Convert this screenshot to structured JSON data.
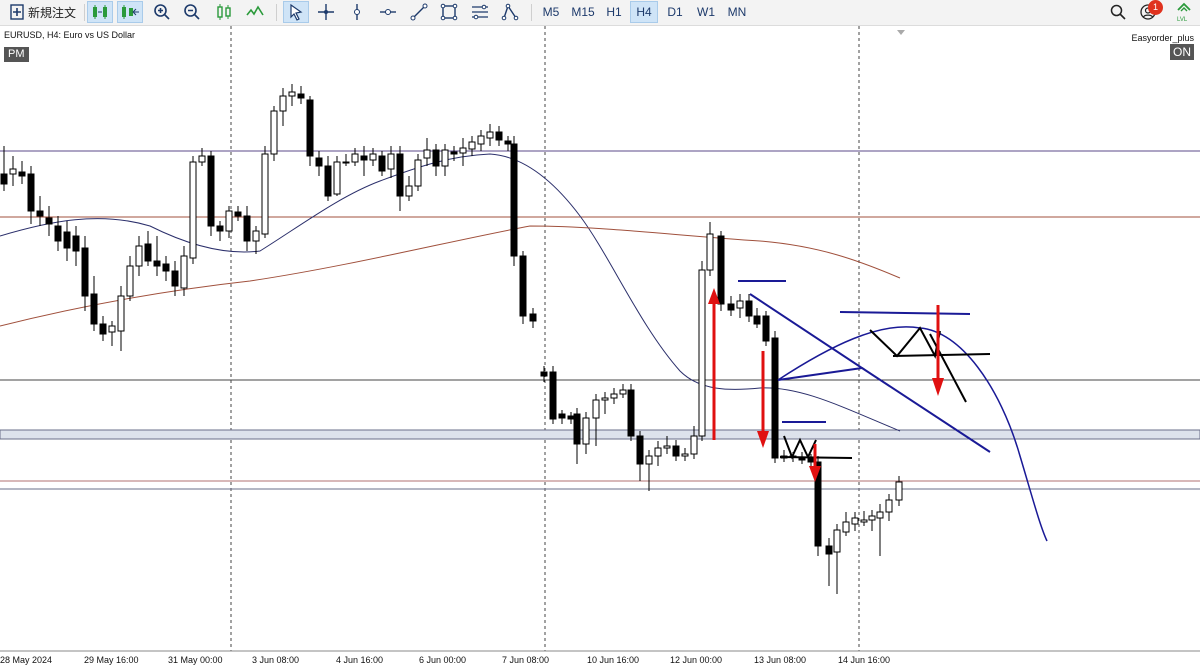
{
  "toolbar": {
    "new_order_label": "新規注文",
    "timeframes": [
      "M5",
      "M15",
      "H1",
      "H4",
      "D1",
      "W1",
      "MN"
    ],
    "active_timeframe": "H4",
    "notification_count": "1"
  },
  "chart": {
    "symbol_label": "EURUSD, H4:  Euro vs US Dollar",
    "session_badge": "PM",
    "ea_label": "Easyorder_plus",
    "ea_status": "ON",
    "x_labels": [
      "28 May 2024",
      "29 May 16:00",
      "31 May 00:00",
      "3 Jun 08:00",
      "4 Jun 16:00",
      "6 Jun 00:00",
      "7 Jun 08:00",
      "10 Jun 16:00",
      "12 Jun 00:00",
      "13 Jun 08:00",
      "14 Jun 16:00"
    ],
    "colors": {
      "bull_body": "#ffffff",
      "bear_body": "#000000",
      "ma_fast": "#2b2f6b",
      "ma_slow": "#a0503c",
      "drawn_lines": "#1a1a96",
      "arrows": "#e01010"
    }
  }
}
